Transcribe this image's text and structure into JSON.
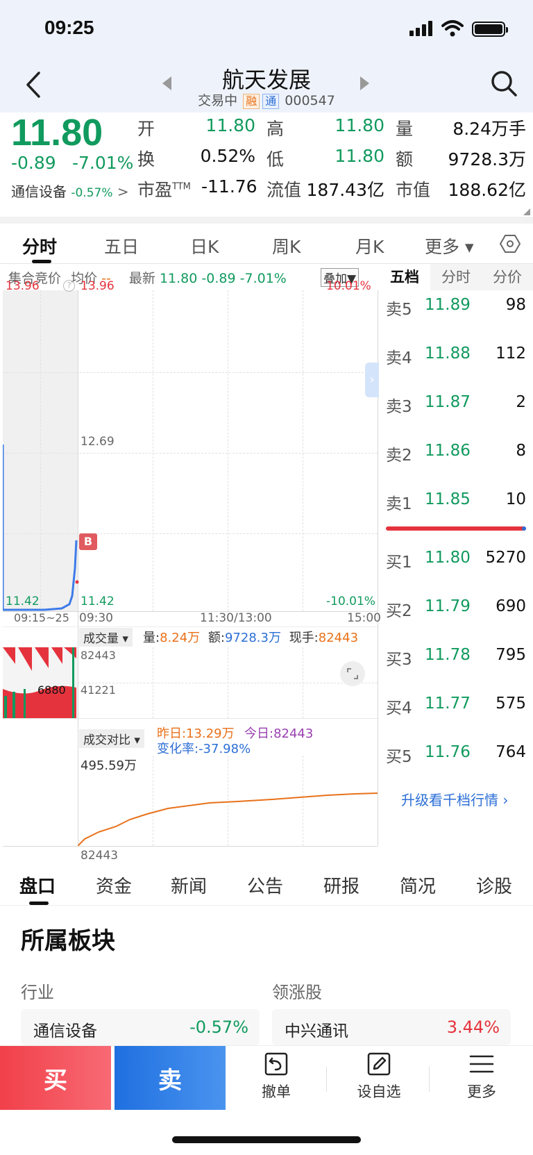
{
  "status_bar": {
    "time": "09:25"
  },
  "header": {
    "title": "航天发展",
    "status": "交易中",
    "tag_rong": "融",
    "tag_tong": "通",
    "code": "000547"
  },
  "quote": {
    "price": "11.80",
    "change": "-0.89",
    "change_pct": "-7.01%",
    "sector": "通信设备",
    "sector_pct": "-0.57%",
    "rows": [
      [
        {
          "l": "开",
          "v": "11.80",
          "c": "green"
        },
        {
          "l": "高",
          "v": "11.80",
          "c": "green"
        },
        {
          "l": "量",
          "v": "8.24万手",
          "c": "dark"
        }
      ],
      [
        {
          "l": "换",
          "v": "0.52%",
          "c": "dark"
        },
        {
          "l": "低",
          "v": "11.80",
          "c": "green"
        },
        {
          "l": "额",
          "v": "9728.3万",
          "c": "dark"
        }
      ],
      [
        {
          "l": "市盈",
          "v": "-11.76",
          "c": "dark"
        },
        {
          "l": "流值",
          "v": "187.43亿",
          "c": "dark"
        },
        {
          "l": "市值",
          "v": "188.62亿",
          "c": "dark"
        }
      ]
    ],
    "ttm_sup": "TTM"
  },
  "chart_tabs": [
    "分时",
    "五日",
    "日K",
    "周K",
    "月K",
    "更多 ▾"
  ],
  "chart_info": {
    "auction": "集合竞价",
    "avg_label": "均价",
    "avg_val": "--",
    "latest_label": "最新",
    "latest_price": "11.80",
    "latest_change": "-0.89",
    "latest_pct": "-7.01%",
    "overlay": "叠加▼"
  },
  "price_chart": {
    "top_left": "13.96",
    "top_left2": "13.96",
    "mid": "12.69",
    "bottom_left": "11.42",
    "bottom_left2": "11.42",
    "top_right": "10.01%",
    "bottom_right": "-10.01%",
    "buy_marker": "B",
    "t_auction": "09:15~25",
    "t_open": "09:30",
    "t_mid": "11:30/13:00",
    "t_close": "15:00"
  },
  "volume_chart": {
    "selector": "成交量 ▾",
    "vol_label": "量:",
    "vol_val": "8.24万",
    "amt_label": "额:",
    "amt_val": "9728.3万",
    "cur_label": "现手:",
    "cur_val": "82443",
    "max": "82443",
    "mid": "41221",
    "auction_label": "6880"
  },
  "compare_chart": {
    "selector": "成交对比 ▾",
    "yesterday": "昨日:13.29万",
    "today": "今日:82443",
    "rate": "变化率:-37.98%",
    "top": "495.59万",
    "bottom": "82443"
  },
  "order_book": {
    "tabs": [
      "五档",
      "分时",
      "分价"
    ],
    "asks": [
      {
        "label": "卖5",
        "price": "11.89",
        "vol": "98"
      },
      {
        "label": "卖4",
        "price": "11.88",
        "vol": "112"
      },
      {
        "label": "卖3",
        "price": "11.87",
        "vol": "2"
      },
      {
        "label": "卖2",
        "price": "11.86",
        "vol": "8"
      },
      {
        "label": "卖1",
        "price": "11.85",
        "vol": "10"
      }
    ],
    "bids": [
      {
        "label": "买1",
        "price": "11.80",
        "vol": "5270"
      },
      {
        "label": "买2",
        "price": "11.79",
        "vol": "690"
      },
      {
        "label": "买3",
        "price": "11.78",
        "vol": "795"
      },
      {
        "label": "买4",
        "price": "11.77",
        "vol": "575"
      },
      {
        "label": "买5",
        "price": "11.76",
        "vol": "764"
      }
    ],
    "upgrade": "升级看千档行情 ›"
  },
  "bottom_tabs": [
    "盘口",
    "资金",
    "新闻",
    "公告",
    "研报",
    "简况",
    "诊股"
  ],
  "sector_panel": {
    "title": "所属板块",
    "industry_label": "行业",
    "leader_label": "领涨股",
    "industry_name": "通信设备",
    "industry_pct": "-0.57%",
    "leader_name": "中兴通讯",
    "leader_pct": "3.44%"
  },
  "bottom_bar": {
    "buy": "买",
    "sell": "卖",
    "cancel": "撤单",
    "watchlist": "设自选",
    "more": "更多"
  }
}
